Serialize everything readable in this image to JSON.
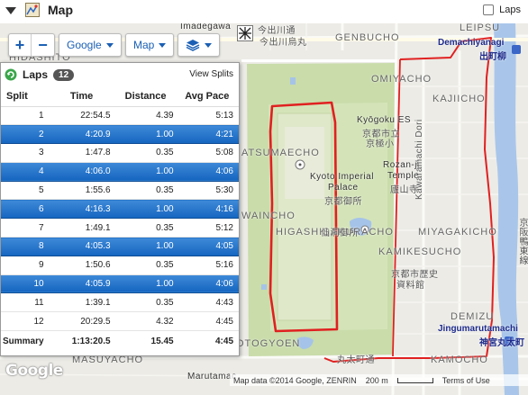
{
  "header": {
    "title": "Map",
    "laps_label": "Laps",
    "colors": {
      "accent": "#1565c0",
      "route": "#e02020",
      "park": "#c8dba8"
    }
  },
  "controls": {
    "map_type": "Google",
    "layer": "Map",
    "zoom_in": "+",
    "zoom_out": "−",
    "icons": [
      "zoom-in-icon",
      "zoom-out-icon",
      "layers-icon",
      "fullscreen-icon",
      "caret-down-icon"
    ]
  },
  "laps": {
    "title": "Laps",
    "count": "12",
    "view_splits": "View Splits",
    "columns": [
      "Split",
      "Time",
      "Distance",
      "Avg Pace"
    ],
    "rows": [
      {
        "split": "1",
        "time": "22:54.5",
        "distance": "4.39",
        "pace": "5:13",
        "highlight": false
      },
      {
        "split": "2",
        "time": "4:20.9",
        "distance": "1.00",
        "pace": "4:21",
        "highlight": true
      },
      {
        "split": "3",
        "time": "1:47.8",
        "distance": "0.35",
        "pace": "5:08",
        "highlight": false
      },
      {
        "split": "4",
        "time": "4:06.0",
        "distance": "1.00",
        "pace": "4:06",
        "highlight": true
      },
      {
        "split": "5",
        "time": "1:55.6",
        "distance": "0.35",
        "pace": "5:30",
        "highlight": false
      },
      {
        "split": "6",
        "time": "4:16.3",
        "distance": "1.00",
        "pace": "4:16",
        "highlight": true
      },
      {
        "split": "7",
        "time": "1:49.1",
        "distance": "0.35",
        "pace": "5:12",
        "highlight": false
      },
      {
        "split": "8",
        "time": "4:05.3",
        "distance": "1.00",
        "pace": "4:05",
        "highlight": true
      },
      {
        "split": "9",
        "time": "1:50.6",
        "distance": "0.35",
        "pace": "5:16",
        "highlight": false
      },
      {
        "split": "10",
        "time": "4:05.9",
        "distance": "1.00",
        "pace": "4:06",
        "highlight": true
      },
      {
        "split": "11",
        "time": "1:39.1",
        "distance": "0.35",
        "pace": "4:43",
        "highlight": false
      },
      {
        "split": "12",
        "time": "20:29.5",
        "distance": "4.32",
        "pace": "4:45",
        "highlight": false
      }
    ],
    "summary": {
      "label": "Summary",
      "time": "1:13:20.5",
      "distance": "15.45",
      "pace": "4:45"
    }
  },
  "map_labels": {
    "imadegawa": "Imadegawa",
    "imadegawa_jp": "今出川通",
    "karasuma_jp": "今出川烏丸",
    "genbucho": "GENBUCHO",
    "demachiyanagi": "Demachiyanagi",
    "demachiyanagi_jp": "出町柳",
    "leipsu": "LEIPSU",
    "hidashito": "HIDASHITO",
    "omiyacho": "OMIYACHO",
    "kajiicho": "KAJIICHO",
    "kyogoku": "Kyōgoku ES",
    "kyogoku_jp": "京都市立",
    "kyogoku_jp2": "京極小",
    "matsumaecho": "ATSUMAECHO",
    "palace": "Kyoto Imperial",
    "palace2": "Palace",
    "palace_jp": "京都御所",
    "rozan": "Rozan-ji",
    "rozan2": "Temple",
    "rozan_jp": "廬山寺",
    "kawaramachi": "Kawaramachi Dori",
    "waincho": "WAINCHO",
    "higashi": "HIGASHISAKURACHO",
    "miyagaki": "MIYAGAKICHO",
    "sento_jp": "仙洞御所",
    "kamikesucho": "KAMIKESUCHO",
    "museum_jp": "京都市歴史",
    "museum_jp2": "資料館",
    "demizu": "DEMIZU",
    "jingu": "Jingumarutamachi",
    "jingu_jp": "神宮丸太町",
    "otogyoen": "OTOGYOEN",
    "marutamachi_jp": "丸太町通",
    "masuyacho": "MASUYACHO",
    "marutamac": "Marutamac",
    "kamocho": "KAMOCHO",
    "keihan_jp": "京阪鴨東線"
  },
  "attribution": {
    "google": "Google",
    "data": "Map data ©2014 Google, ZENRIN",
    "scale": "200 m",
    "terms": "Terms of Use"
  }
}
